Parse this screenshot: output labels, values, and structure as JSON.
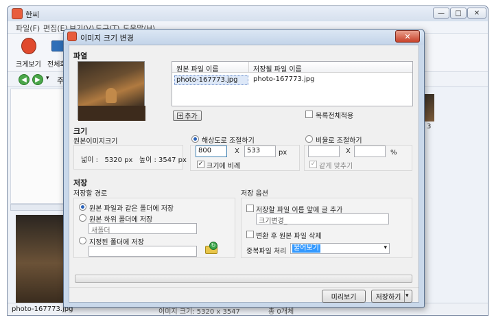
{
  "main_window": {
    "title": "한씨",
    "menu": [
      "파일(F)",
      "편집(E)",
      "보기(V)",
      "도구(T)",
      "도움말(H)"
    ],
    "toolbar": [
      {
        "label": "크게보기"
      },
      {
        "label": "전체화"
      }
    ],
    "nav_text": "주",
    "side_number": "3",
    "status": {
      "filename": "photo-167773.jpg",
      "info": "이미지 크기: 5320 x 3547",
      "count": "총 0개체"
    },
    "win_buttons": {
      "minimize": "—",
      "maximize": "□",
      "close": "✕"
    }
  },
  "dialog": {
    "title": "이미지 크기 변경",
    "close_label": "✕",
    "file_section": {
      "title": "파열",
      "columns": [
        "원본 파일 이름",
        "저장될 파일 이름"
      ],
      "rows": [
        {
          "original": "photo-167773.jpg",
          "target": "photo-167773.jpg"
        }
      ],
      "add_label": "추가",
      "apply_all_label": "목록전체적용"
    },
    "size_section": {
      "title": "크기",
      "original_label": "원본이미지크기",
      "original_size": "넓이 :   5320 px   높이 : 3547 px",
      "by_resolution_label": "해상도로 조절하기",
      "width": "800",
      "height": "533",
      "times": "X",
      "unit_px": "px",
      "keep_ratio_label": "크기에 비례",
      "by_ratio_label": "비율로 조절하기",
      "ratio_x": "",
      "ratio_y": "",
      "percent": "%",
      "same_ratio_label": "같게 맞추기"
    },
    "save_section": {
      "title": "저장",
      "path_title": "저장할 경로",
      "same_folder_label": "원본 파일과 같은 폴더에 저장",
      "subfolder_label": "원본 하위 폴더에 저장",
      "subfolder_value": "새폴더",
      "custom_folder_label": "지정된 폴더에 저장",
      "custom_folder_value": "",
      "options_title": "저장 옵션",
      "prefix_label": "저장할 파일 이름 앞에 글 추가",
      "prefix_value": "크기변경_",
      "delete_original_label": "변환 후 원본 파일 삭제",
      "duplicate_label": "중복파일 처리",
      "duplicate_value": "물어보기"
    },
    "buttons": {
      "preview": "미리보기",
      "save": "저장하기"
    }
  },
  "colors": {
    "selection": "#3399ff",
    "dialog_frame": "#c9d8ea",
    "close_red": "#c8422a"
  }
}
